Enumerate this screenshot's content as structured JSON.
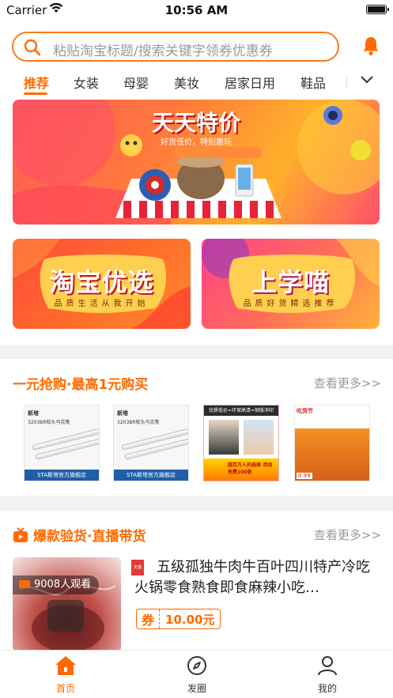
{
  "status_bar": {
    "carrier": "Carrier",
    "time": "10:56 AM"
  },
  "search": {
    "placeholder": "粘贴淘宝标题/搜索关键字领券优惠券"
  },
  "tabs": [
    {
      "label": "推荐",
      "active": true
    },
    {
      "label": "女装"
    },
    {
      "label": "母婴"
    },
    {
      "label": "美妆"
    },
    {
      "label": "居家日用"
    },
    {
      "label": "鞋品"
    }
  ],
  "banner": {
    "title": "天天特价",
    "subtitle": "好货低价，特别惠玩"
  },
  "promos": [
    {
      "title": "淘宝优选",
      "subtitle": "品质生活从我开始"
    },
    {
      "title": "上学喵",
      "subtitle": "品质好货精选推荐"
    }
  ],
  "section_one": {
    "title": "一元抢购·最高1元购买",
    "more": "查看更多>>"
  },
  "thumbs": {
    "pen1": {
      "brand": "斯塔",
      "model": "3203BR软头马克笔",
      "footer": "STA斯塔官方旗舰店"
    },
    "pen2": {
      "brand": "斯塔",
      "model": "3203BR软头马克笔",
      "footer": "STA斯塔官方旗舰店"
    },
    "poster": {
      "top": "优质低价=环保高清=铜版冲印",
      "bottom": "超百万人的选择 活动免费100张"
    },
    "snack": {
      "tag": "吃货节",
      "price": "0.99"
    }
  },
  "section_two": {
    "title": "爆款验货·直播带货",
    "more": "查看更多>>"
  },
  "product": {
    "viewers": "9008人观看",
    "shop_badge": "天猫",
    "title": "五级孤独牛肉牛百叶四川特产冷吃火锅零食熟食即食麻辣小吃…",
    "coupon_key": "券",
    "coupon_value": "10.00元"
  },
  "tabbar": [
    {
      "label": "首页",
      "active": true
    },
    {
      "label": "发圈"
    },
    {
      "label": "我的"
    }
  ],
  "colors": {
    "accent": "#ff6a00",
    "divider": "#f2f2f2"
  }
}
